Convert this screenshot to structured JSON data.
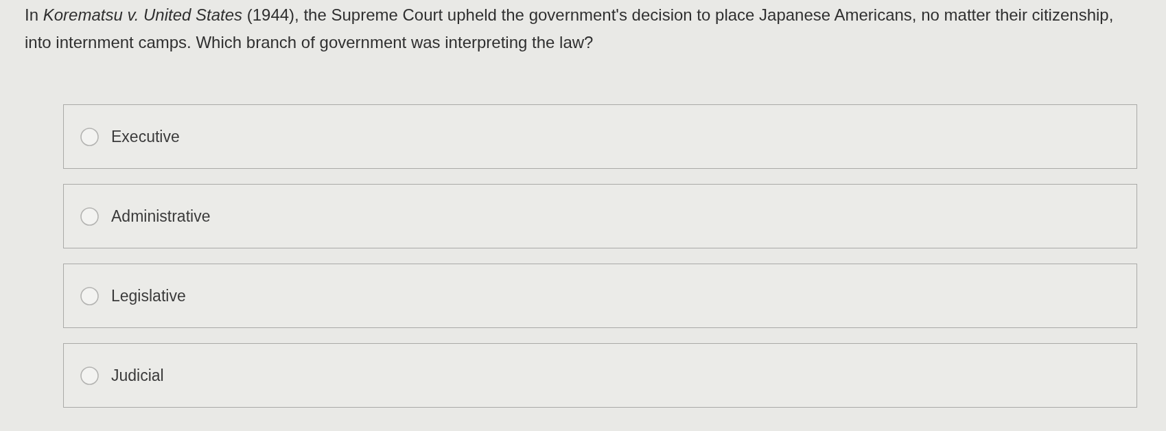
{
  "question": {
    "text": "In *Korematsu v. United States* (1944), the Supreme Court upheld the government's decision to place Japanese Americans, no matter their citizenship, into internment camps. Which branch of government was interpreting the law?"
  },
  "options": [
    {
      "label": "Executive",
      "selected": false
    },
    {
      "label": "Administrative",
      "selected": false
    },
    {
      "label": "Legislative",
      "selected": false
    },
    {
      "label": "Judicial",
      "selected": false
    }
  ]
}
